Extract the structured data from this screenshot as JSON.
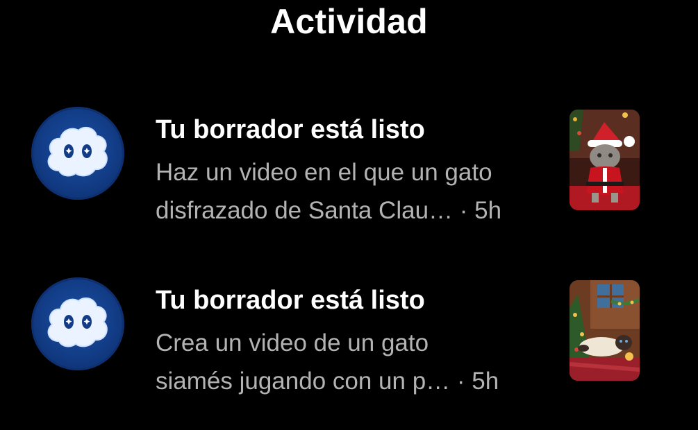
{
  "header": {
    "title": "Actividad"
  },
  "notifications": [
    {
      "title": "Tu borrador está listo",
      "line1": "Haz un video en el que un gato",
      "line2": "disfrazado de Santa Clau…",
      "time": " · 5h",
      "avatar_icon": "app-cloud-mascot-icon",
      "thumbnail": "santa-cat-video-thumbnail"
    },
    {
      "title": "Tu borrador está listo",
      "line1": "Crea un video de un gato",
      "line2": "siamés jugando con un p…",
      "time": " · 5h",
      "avatar_icon": "app-cloud-mascot-icon",
      "thumbnail": "siamese-cat-video-thumbnail"
    }
  ],
  "colors": {
    "background": "#000000",
    "title_text": "#ffffff",
    "secondary_text": "#b3b3b3",
    "avatar_blue": "#123c86"
  }
}
